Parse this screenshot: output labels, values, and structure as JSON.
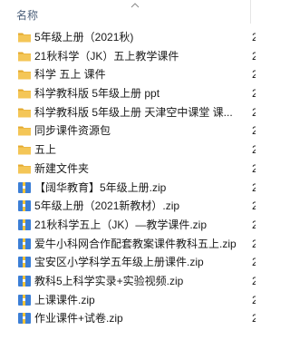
{
  "header": {
    "name_column": "名称",
    "sort_icon": "chevron-up-icon"
  },
  "items": [
    {
      "type": "folder",
      "name": "5年级上册（2021秋)"
    },
    {
      "type": "folder",
      "name": "21秋科学（JK）五上教学课件"
    },
    {
      "type": "folder",
      "name": "科学 五上 课件"
    },
    {
      "type": "folder",
      "name": "科学教科版 5年级上册 ppt"
    },
    {
      "type": "folder",
      "name": "科学教科版 5年级上册 天津空中课堂 课..."
    },
    {
      "type": "folder",
      "name": "同步课件资源包"
    },
    {
      "type": "folder",
      "name": "五上"
    },
    {
      "type": "folder",
      "name": "新建文件夹"
    },
    {
      "type": "zip",
      "name": "【阔华教育】5年级上册.zip"
    },
    {
      "type": "zip",
      "name": "5年级上册（2021新教材）.zip"
    },
    {
      "type": "zip",
      "name": "21秋科学五上（JK）—教学课件.zip"
    },
    {
      "type": "zip",
      "name": "爱牛小科网合作配套教案课件教科五上.zip"
    },
    {
      "type": "zip",
      "name": "宝安区小学科学五年级上册课件.zip"
    },
    {
      "type": "zip",
      "name": "教科5上科学实录+实验视频.zip"
    },
    {
      "type": "zip",
      "name": "上课课件.zip"
    },
    {
      "type": "zip",
      "name": "作业课件+试卷.zip"
    }
  ],
  "edge_marks": [
    "2",
    "2",
    "2",
    "2",
    "2",
    "2",
    "2",
    "2",
    "2",
    "2",
    "2",
    "2",
    "2",
    "2",
    "2",
    "2"
  ],
  "colors": {
    "folder": "#f4c657",
    "folder_dark": "#e3a92f",
    "zip_blue": "#3b7ed6",
    "zip_yellow": "#f0c23b"
  }
}
